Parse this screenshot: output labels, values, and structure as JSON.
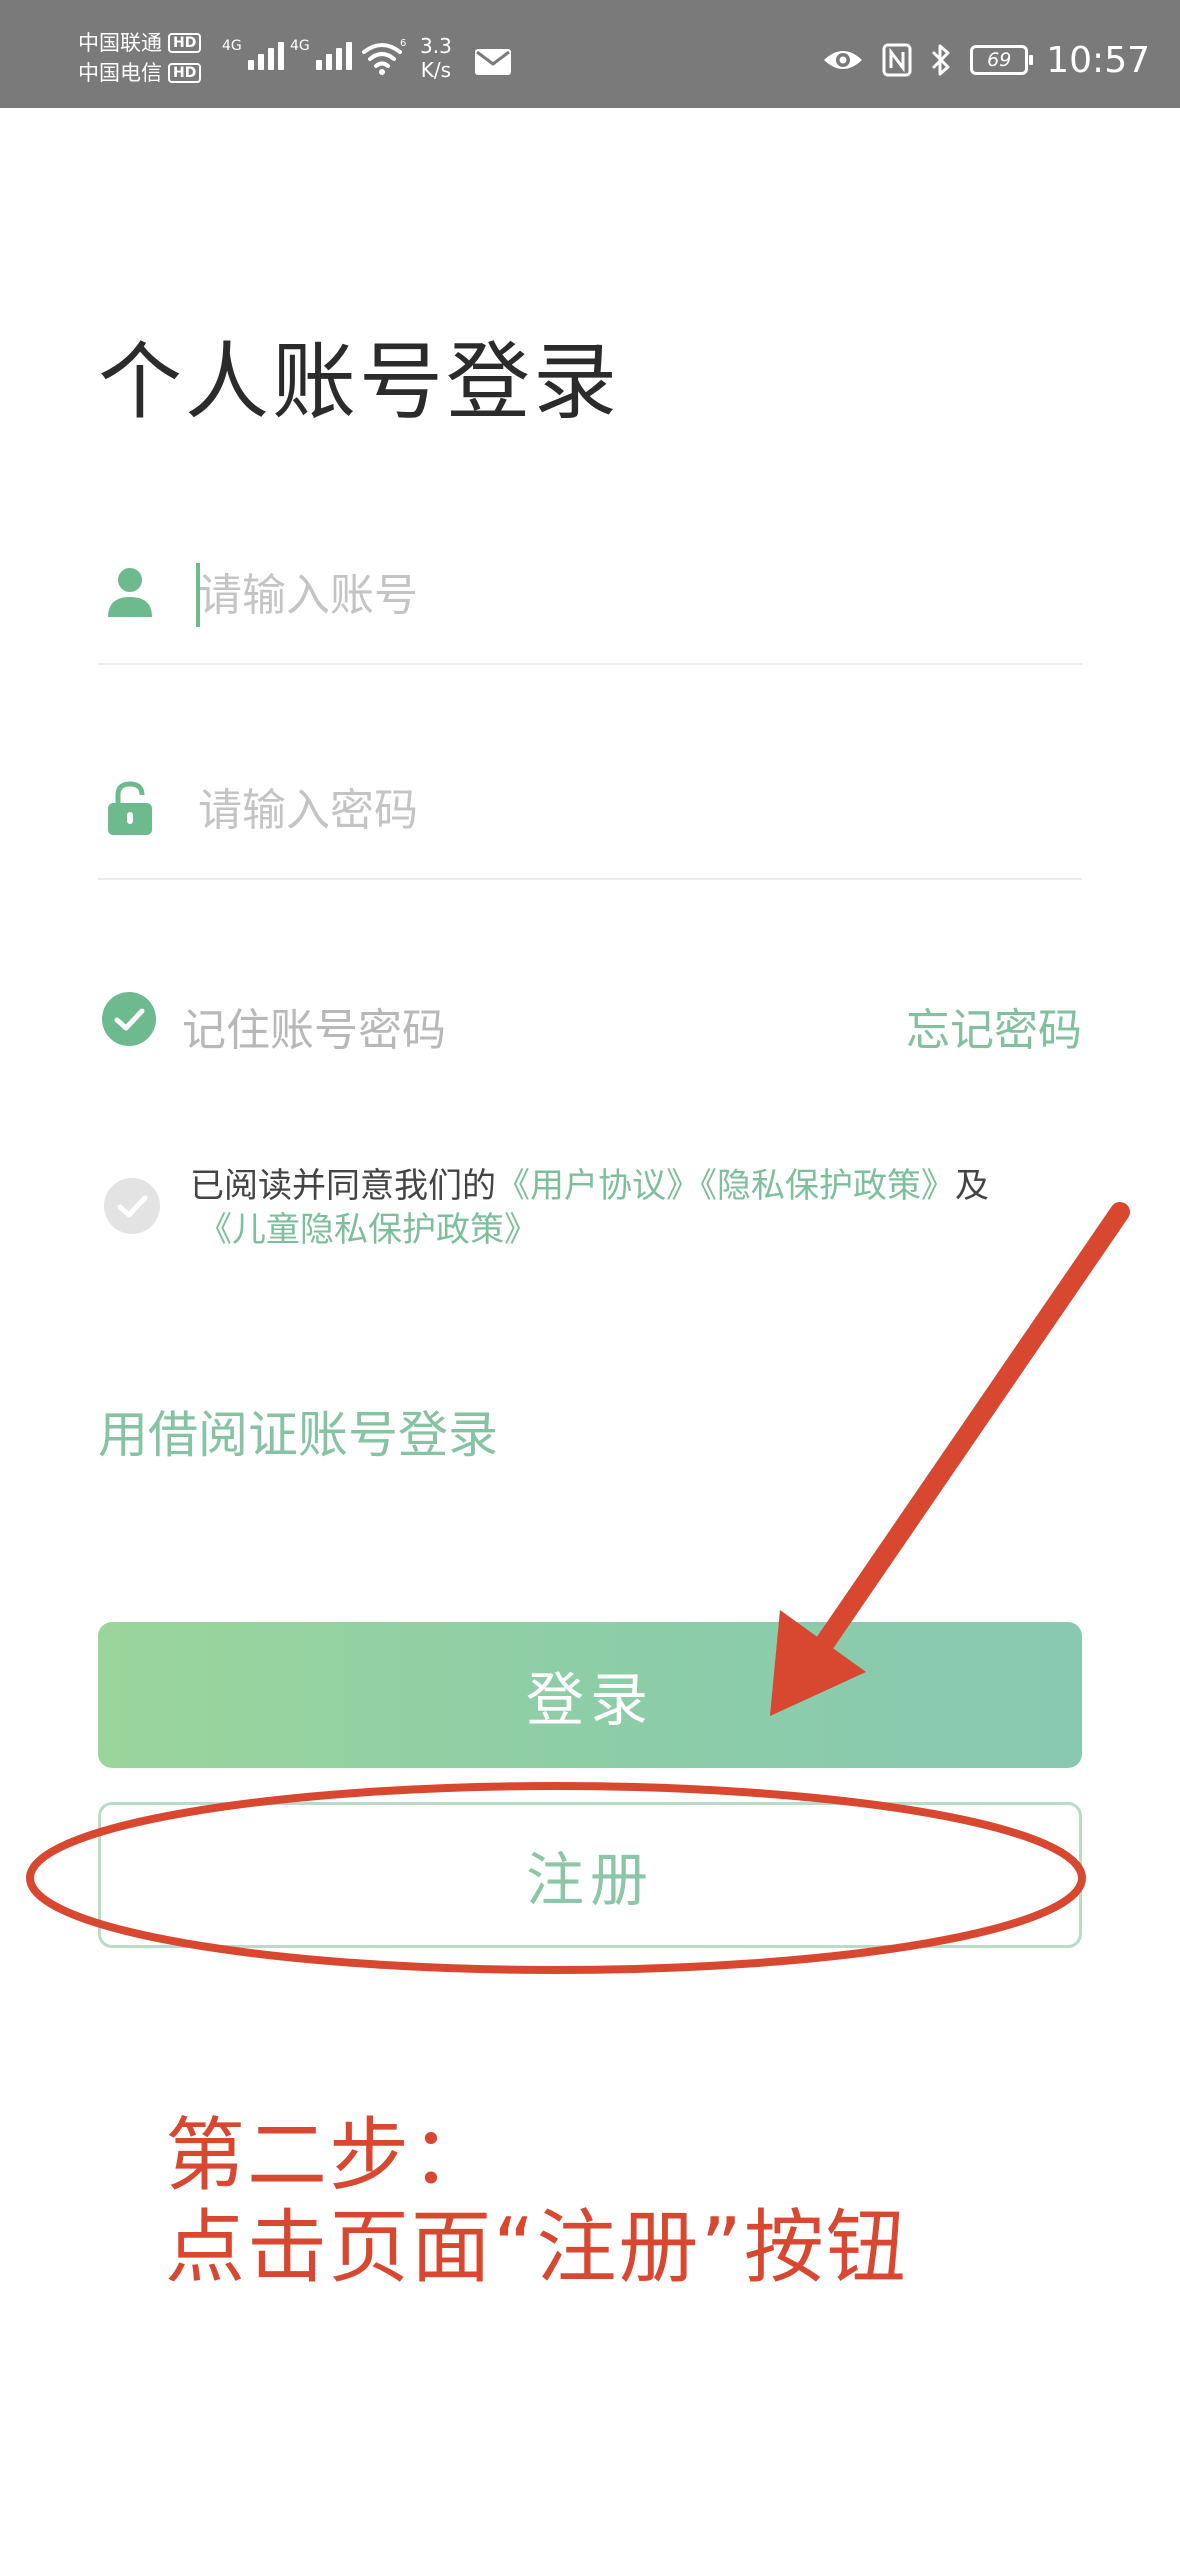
{
  "status_bar": {
    "carrier_1": "中国联通",
    "carrier_2": "中国电信",
    "hd_badge": "HD",
    "network_1": "4G",
    "network_2": "4G",
    "wifi_tag": "6",
    "speed_value": "3.3",
    "speed_unit": "K/s",
    "battery": "69",
    "time": "10:57",
    "icons": [
      "signal-icon",
      "wifi-icon",
      "mail-icon",
      "eye-icon",
      "nfc-icon",
      "bluetooth-icon",
      "battery-icon"
    ]
  },
  "login": {
    "title": "个人账号登录",
    "account_placeholder": "请输入账号",
    "password_placeholder": "请输入密码",
    "remember_label": "记住账号密码",
    "forgot_label": "忘记密码",
    "agree_prefix": "已阅读并同意我们的",
    "user_agreement": "《用户协议》",
    "privacy_policy": "《隐私保护政策》",
    "agree_and": "及",
    "child_privacy_policy": "《儿童隐私保护政策》",
    "card_login_link": "用借阅证账号登录",
    "login_button": "登录",
    "register_button": "注册"
  },
  "annotation": {
    "step_title": "第二步：",
    "step_instruction": "点击页面“注册”按钮",
    "color": "#d8472f"
  },
  "colors": {
    "accent": "#6cba8e",
    "link": "#7dbf9b",
    "status_bar": "#7a7a7a"
  }
}
